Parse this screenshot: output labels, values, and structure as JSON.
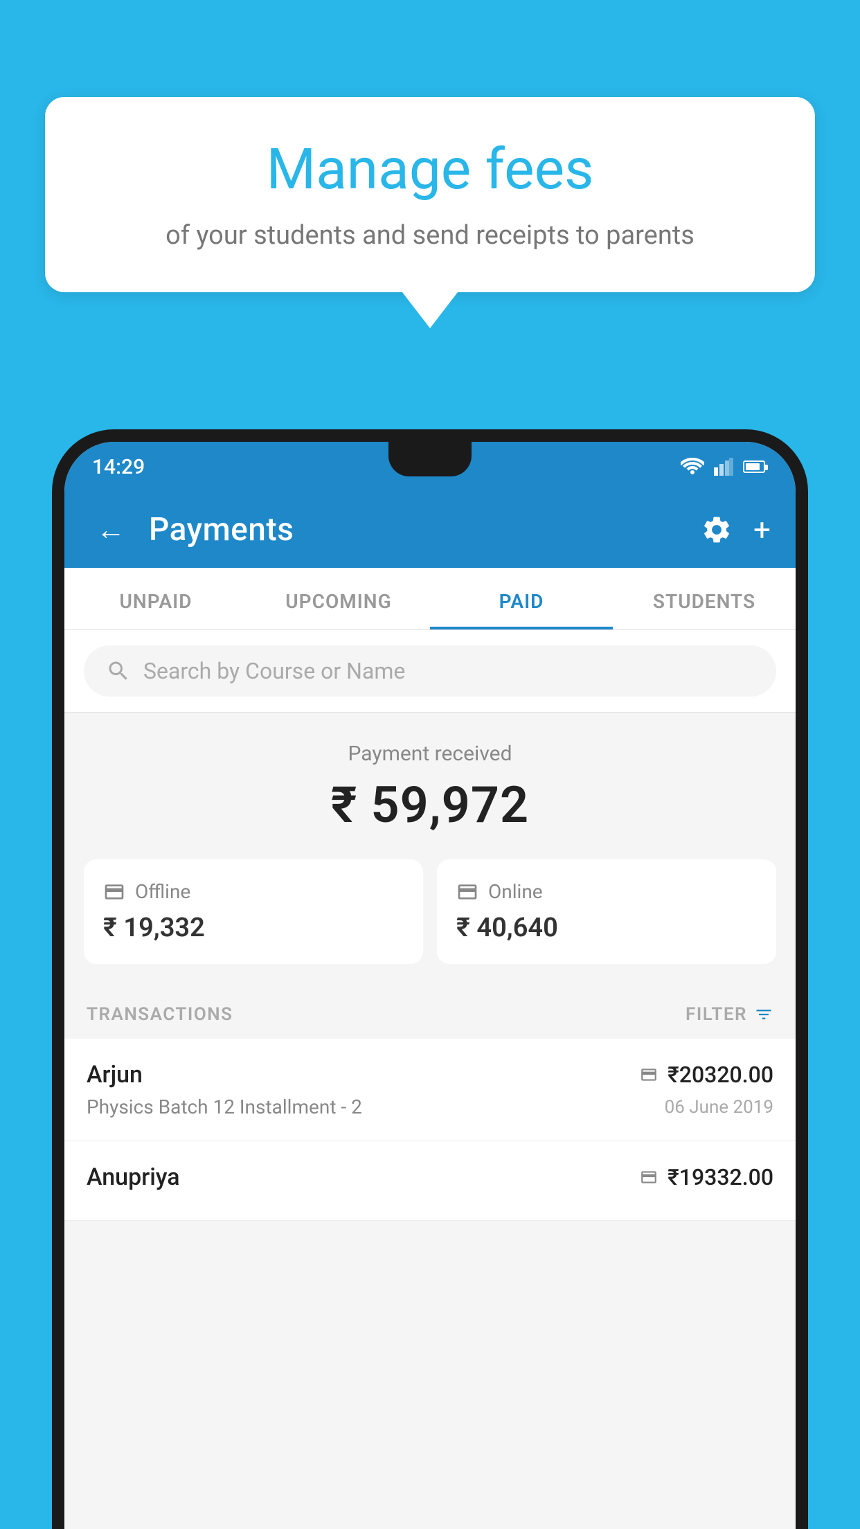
{
  "background_color": "#29b6e8",
  "bubble": {
    "title": "Manage fees",
    "subtitle": "of your students and send receipts to parents"
  },
  "status_bar": {
    "time": "14:29",
    "color": "#1e88c9"
  },
  "app_bar": {
    "title": "Payments",
    "back_label": "←",
    "settings_label": "⚙",
    "add_label": "+"
  },
  "tabs": [
    {
      "label": "UNPAID",
      "active": false
    },
    {
      "label": "UPCOMING",
      "active": false
    },
    {
      "label": "PAID",
      "active": true
    },
    {
      "label": "STUDENTS",
      "active": false
    }
  ],
  "search": {
    "placeholder": "Search by Course or Name"
  },
  "payment_summary": {
    "label": "Payment received",
    "total": "₹ 59,972",
    "offline_label": "Offline",
    "offline_amount": "₹ 19,332",
    "online_label": "Online",
    "online_amount": "₹ 40,640"
  },
  "transactions": {
    "header": "TRANSACTIONS",
    "filter_label": "FILTER",
    "rows": [
      {
        "name": "Arjun",
        "course": "Physics Batch 12 Installment - 2",
        "amount": "₹20320.00",
        "date": "06 June 2019",
        "type": "online"
      },
      {
        "name": "Anupriya",
        "course": "",
        "amount": "₹19332.00",
        "date": "",
        "type": "offline"
      }
    ]
  }
}
